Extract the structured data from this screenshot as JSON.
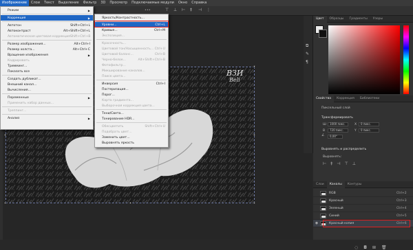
{
  "menubar": {
    "items": [
      {
        "label": "Изображение",
        "active": true
      },
      {
        "label": "Слои"
      },
      {
        "label": "Текст"
      },
      {
        "label": "Выделение"
      },
      {
        "label": "Фильтр"
      },
      {
        "label": "3D"
      },
      {
        "label": "Просмотр"
      },
      {
        "label": "Подключаемые модули"
      },
      {
        "label": "Окно"
      },
      {
        "label": "Справка"
      }
    ]
  },
  "image_menu": {
    "items": [
      {
        "label": "Режим",
        "shortcut": "",
        "submenu": true,
        "disabled": false
      },
      {
        "label": "Коррекция",
        "shortcut": "",
        "submenu": true,
        "disabled": false,
        "highlight": true
      },
      {
        "label": "Автотон",
        "shortcut": "Shift+Ctrl+L",
        "disabled": false
      },
      {
        "label": "Автоконтраст",
        "shortcut": "Alt+Shift+Ctrl+L",
        "disabled": false
      },
      {
        "label": "Автоматическая цветовая коррекция",
        "shortcut": "Shift+Ctrl+B",
        "disabled": true
      },
      {
        "label": "Размер изображения...",
        "shortcut": "Alt+Ctrl+I",
        "disabled": false
      },
      {
        "label": "Размер холста...",
        "shortcut": "Alt+Ctrl+C",
        "disabled": false
      },
      {
        "label": "Вращение изображения",
        "shortcut": "",
        "submenu": true,
        "disabled": false
      },
      {
        "label": "Кадрировать",
        "shortcut": "",
        "disabled": true
      },
      {
        "label": "Тримминг...",
        "shortcut": "",
        "disabled": false
      },
      {
        "label": "Показать все",
        "shortcut": "",
        "disabled": false
      },
      {
        "label": "Создать дубликат...",
        "shortcut": "",
        "disabled": false
      },
      {
        "label": "Внешний канал...",
        "shortcut": "",
        "disabled": false
      },
      {
        "label": "Вычисления...",
        "shortcut": "",
        "disabled": false
      },
      {
        "label": "Переменные",
        "shortcut": "",
        "submenu": true,
        "disabled": false
      },
      {
        "label": "Применить набор данных...",
        "shortcut": "",
        "disabled": true
      },
      {
        "label": "Треппинг...",
        "shortcut": "",
        "disabled": true
      },
      {
        "label": "Анализ",
        "shortcut": "",
        "submenu": true,
        "disabled": false
      }
    ]
  },
  "correction_menu": {
    "items": [
      {
        "label": "Яркость/Контрастность...",
        "shortcut": "",
        "disabled": false
      },
      {
        "label": "Уровни...",
        "shortcut": "Ctrl+L",
        "disabled": false,
        "highlight": true
      },
      {
        "label": "Кривые...",
        "shortcut": "Ctrl+M",
        "disabled": false
      },
      {
        "label": "Экспозиция...",
        "shortcut": "",
        "disabled": true
      },
      {
        "label": "Красочность...",
        "shortcut": "",
        "disabled": true
      },
      {
        "label": "Цветовой тон/Насыщенность...",
        "shortcut": "Ctrl+U",
        "disabled": true
      },
      {
        "label": "Цветовой баланс...",
        "shortcut": "Ctrl+B",
        "disabled": true
      },
      {
        "label": "Черно-белое...",
        "shortcut": "Alt+Shift+Ctrl+B",
        "disabled": true
      },
      {
        "label": "Фотофильтр...",
        "shortcut": "",
        "disabled": true
      },
      {
        "label": "Микширование каналов...",
        "shortcut": "",
        "disabled": true
      },
      {
        "label": "Поиск цвета...",
        "shortcut": "",
        "disabled": true
      },
      {
        "label": "Инверсия",
        "shortcut": "Ctrl+I",
        "disabled": false
      },
      {
        "label": "Постеризация...",
        "shortcut": "",
        "disabled": false
      },
      {
        "label": "Порог...",
        "shortcut": "",
        "disabled": false
      },
      {
        "label": "Карта градиента...",
        "shortcut": "",
        "disabled": true
      },
      {
        "label": "Выборочная коррекция цвета...",
        "shortcut": "",
        "disabled": true
      },
      {
        "label": "Тени/Света...",
        "shortcut": "",
        "disabled": false
      },
      {
        "label": "Тонирование HDR...",
        "shortcut": "",
        "disabled": false
      },
      {
        "label": "Обесцветить",
        "shortcut": "Shift+Ctrl+U",
        "disabled": true
      },
      {
        "label": "Подобрать цвет...",
        "shortcut": "",
        "disabled": true
      },
      {
        "label": "Заменить цвет...",
        "shortcut": "",
        "disabled": false
      },
      {
        "label": "Выровнять яркость",
        "shortcut": "",
        "disabled": false
      }
    ]
  },
  "panel_tabs": {
    "top": [
      "Цвет",
      "Образцы",
      "Градиенты",
      "Узоры"
    ],
    "middle": [
      "Свойства",
      "Коррекция",
      "Библиотеки"
    ],
    "bottom": [
      "Слои",
      "Каналы",
      "Контуры"
    ]
  },
  "properties": {
    "layer_type": "Пиксельный слой",
    "transform_title": "Трансформировать",
    "w_label": "Ш",
    "w_value": "1000 пикс.",
    "x_label": "X",
    "x_value": "0 пикс.",
    "h_label": "В",
    "h_value": "720 пикс.",
    "y_label": "Y",
    "y_value": "0 пикс.",
    "angle_value": "0,00°",
    "align_title": "Выровнять и распределить",
    "align_sub": "Выровнять:"
  },
  "channels": [
    {
      "name": "RGB",
      "shortcut": "Ctrl+2"
    },
    {
      "name": "Красный",
      "shortcut": "Ctrl+3"
    },
    {
      "name": "Зеленый",
      "shortcut": "Ctrl+4"
    },
    {
      "name": "Синий",
      "shortcut": "Ctrl+5"
    },
    {
      "name": "Красный копия",
      "shortcut": "Ctrl+6",
      "selected": true
    }
  ],
  "watermark": {
    "line1": "ВЗИ",
    "line2": "Beli"
  },
  "colors": {
    "accent": "#1f66c4",
    "annotation_red": "#e02020",
    "menu_bg": "#f0f0f0"
  }
}
